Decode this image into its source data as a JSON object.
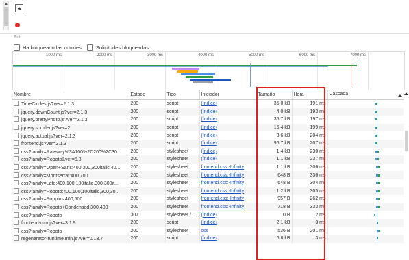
{
  "toolbar": {
    "filter_placeholder": "Filtr",
    "blocked_cookies_label": "Ha bloqueado las cookies",
    "blocked_requests_label": "Solicitudes bloqueadas"
  },
  "timeline": {
    "ticks": [
      "1000 ms",
      "2000 ms",
      "3000 ms",
      "4000 ms",
      "5000 ms",
      "6000 ms",
      "7000 ms"
    ]
  },
  "columns": {
    "name": "Nombre",
    "status": "Estado",
    "type": "Tipo",
    "initiator": "Iniciador",
    "size": "Tamaño",
    "time": "Hora",
    "waterfall": "Cascada"
  },
  "rows": [
    {
      "name": "TimeCircles.js?ver=2.1.3",
      "status": "200",
      "type": "script",
      "initiator": "(índice)",
      "size": "35.0 kB",
      "time": "191 ms",
      "wf_start": 0.63,
      "wf_len": 0.04
    },
    {
      "name": "jquery.downCount.js?ver=2.1.3",
      "status": "200",
      "type": "script",
      "initiator": "(índice)",
      "size": "4.0 kB",
      "time": "193 ms",
      "wf_start": 0.63,
      "wf_len": 0.04
    },
    {
      "name": "jquery.prettyPhoto.js?ver=2.1.3",
      "status": "200",
      "type": "script",
      "initiator": "(índice)",
      "size": "35.7 kB",
      "time": "197 ms",
      "wf_start": 0.63,
      "wf_len": 0.04
    },
    {
      "name": "jquery.scroller.js?ver=2",
      "status": "200",
      "type": "script",
      "initiator": "(índice)",
      "size": "16.4 kB",
      "time": "199 ms",
      "wf_start": 0.63,
      "wf_len": 0.04
    },
    {
      "name": "jquery.actual.js?ver=2.1.3",
      "status": "200",
      "type": "script",
      "initiator": "(índice)",
      "size": "3.6 kB",
      "time": "204 ms",
      "wf_start": 0.63,
      "wf_len": 0.04
    },
    {
      "name": "frontend.js?ver=2.1.3",
      "status": "200",
      "type": "script",
      "initiator": "(índice)",
      "size": "96.7 kB",
      "time": "207 ms",
      "wf_start": 0.63,
      "wf_len": 0.04
    },
    {
      "name": "css?family=Raleway%3A100%2C200%2C30...",
      "status": "200",
      "type": "stylesheet",
      "initiator": "(índice)",
      "size": "1.4 kB",
      "time": "230 ms",
      "wf_start": 0.64,
      "wf_len": 0.05
    },
    {
      "name": "css?family=Roboto&ver=5.8",
      "status": "200",
      "type": "stylesheet",
      "initiator": "(índice)",
      "size": "1.1 kB",
      "time": "237 ms",
      "wf_start": 0.64,
      "wf_len": 0.05
    },
    {
      "name": "css?family=Open+Sans:400,300,300italic,40...",
      "status": "200",
      "type": "stylesheet",
      "initiator": "frontend.css:-Infinity",
      "size": "1.1 kB",
      "time": "306 ms",
      "wf_start": 0.65,
      "wf_len": 0.06
    },
    {
      "name": "css?family=Montserrat:400,700",
      "status": "200",
      "type": "stylesheet",
      "initiator": "frontend.css:-Infinity",
      "size": "648 B",
      "time": "336 ms",
      "wf_start": 0.65,
      "wf_len": 0.06
    },
    {
      "name": "css?family=Lato:400,100,100italic,300,300it...",
      "status": "200",
      "type": "stylesheet",
      "initiator": "frontend.css:-Infinity",
      "size": "648 B",
      "time": "304 ms",
      "wf_start": 0.65,
      "wf_len": 0.06
    },
    {
      "name": "css?family=Roboto:400,100,100italic,300,30...",
      "status": "200",
      "type": "stylesheet",
      "initiator": "frontend.css:-Infinity",
      "size": "1.2 kB",
      "time": "305 ms",
      "wf_start": 0.65,
      "wf_len": 0.06
    },
    {
      "name": "css?family=Poppins:400,500",
      "status": "200",
      "type": "stylesheet",
      "initiator": "frontend.css:-Infinity",
      "size": "957 B",
      "time": "262 ms",
      "wf_start": 0.65,
      "wf_len": 0.05
    },
    {
      "name": "css?family=Roboto+Condensed:300,400",
      "status": "200",
      "type": "stylesheet",
      "initiator": "frontend.css:-Infinity",
      "size": "718 B",
      "time": "333 ms",
      "wf_start": 0.65,
      "wf_len": 0.06
    },
    {
      "name": "css?family=Roboto",
      "status": "307",
      "type": "stylesheet /...",
      "initiator": "(índice)",
      "size": "0 B",
      "time": "2 ms",
      "wf_start": 0.62,
      "wf_len": 0.01
    },
    {
      "name": "frontend-min.js?ver=3.1.9",
      "status": "200",
      "type": "script",
      "initiator": "(índice)",
      "size": "2.1 kB",
      "time": "3 ms",
      "wf_start": 0.66,
      "wf_len": 0.01
    },
    {
      "name": "css?family=Roboto",
      "status": "200",
      "type": "stylesheet",
      "initiator": "css",
      "size": "536 B",
      "time": "201 ms",
      "wf_start": 0.67,
      "wf_len": 0.04
    },
    {
      "name": "regenerator-runtime.min.js?ver=0.13.7",
      "status": "200",
      "type": "script",
      "initiator": "(índice)",
      "size": "6.8 kB",
      "time": "3 ms",
      "wf_start": 0.66,
      "wf_len": 0.01
    }
  ],
  "colors": {
    "highlight": "#e02020",
    "link": "#1a56c4",
    "waterfall_receive": "#2e9e46",
    "waterfall_wait": "#4a8fe0"
  }
}
